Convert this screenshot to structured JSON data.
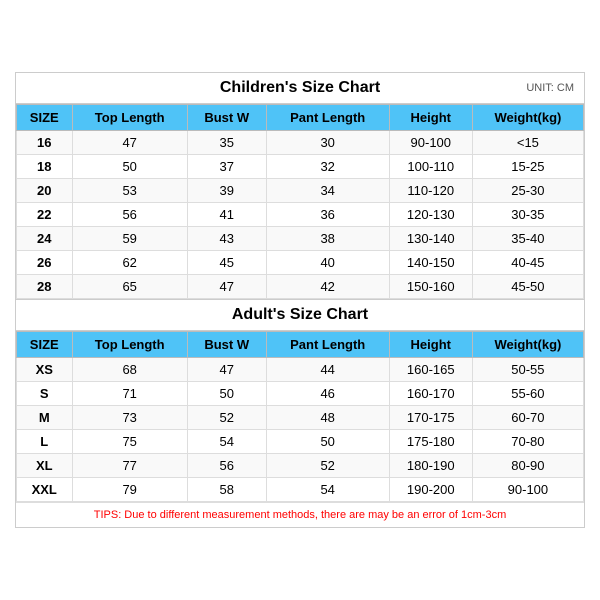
{
  "children_section": {
    "title": "Children's Size Chart",
    "unit": "UNIT: CM",
    "headers": [
      "SIZE",
      "Top Length",
      "Bust W",
      "Pant Length",
      "Height",
      "Weight(kg)"
    ],
    "rows": [
      [
        "16",
        "47",
        "35",
        "30",
        "90-100",
        "<15"
      ],
      [
        "18",
        "50",
        "37",
        "32",
        "100-110",
        "15-25"
      ],
      [
        "20",
        "53",
        "39",
        "34",
        "110-120",
        "25-30"
      ],
      [
        "22",
        "56",
        "41",
        "36",
        "120-130",
        "30-35"
      ],
      [
        "24",
        "59",
        "43",
        "38",
        "130-140",
        "35-40"
      ],
      [
        "26",
        "62",
        "45",
        "40",
        "140-150",
        "40-45"
      ],
      [
        "28",
        "65",
        "47",
        "42",
        "150-160",
        "45-50"
      ]
    ]
  },
  "adults_section": {
    "title": "Adult's Size Chart",
    "headers": [
      "SIZE",
      "Top Length",
      "Bust W",
      "Pant Length",
      "Height",
      "Weight(kg)"
    ],
    "rows": [
      [
        "XS",
        "68",
        "47",
        "44",
        "160-165",
        "50-55"
      ],
      [
        "S",
        "71",
        "50",
        "46",
        "160-170",
        "55-60"
      ],
      [
        "M",
        "73",
        "52",
        "48",
        "170-175",
        "60-70"
      ],
      [
        "L",
        "75",
        "54",
        "50",
        "175-180",
        "70-80"
      ],
      [
        "XL",
        "77",
        "56",
        "52",
        "180-190",
        "80-90"
      ],
      [
        "XXL",
        "79",
        "58",
        "54",
        "190-200",
        "90-100"
      ]
    ]
  },
  "tips": "TIPS: Due to different measurement methods, there are may be an error of 1cm-3cm"
}
